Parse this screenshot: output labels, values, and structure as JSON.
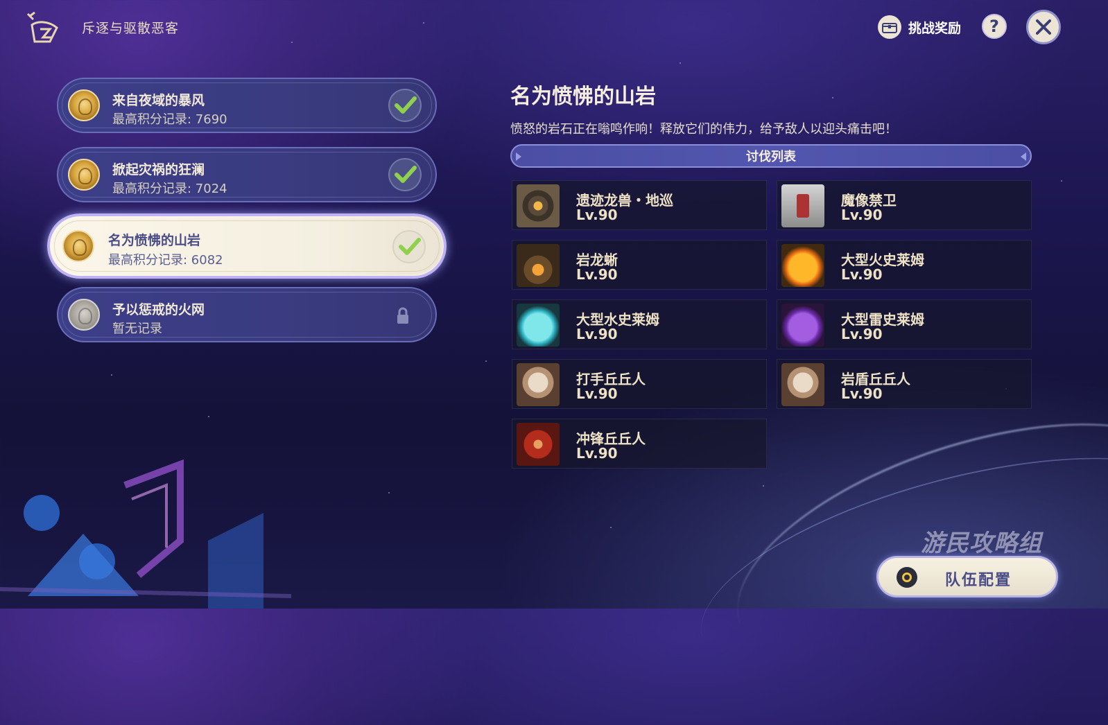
{
  "header": {
    "title": "斥逐与驱散恶客",
    "reward_label": "挑战奖励",
    "help_label": "?",
    "icons": {
      "logo": "event-emblem-icon",
      "reward": "chest-icon",
      "help": "question-icon",
      "close": "close-icon"
    }
  },
  "stages": [
    {
      "name": "来自夜域的暴风",
      "score": "最高积分记录: 7690",
      "status": "completed"
    },
    {
      "name": "掀起灾祸的狂澜",
      "score": "最高积分记录: 7024",
      "status": "completed"
    },
    {
      "name": "名为愤怫的山岩",
      "score": "最高积分记录: 6082",
      "status": "completed-selected"
    },
    {
      "name": "予以惩戒的火网",
      "score": "暂无记录",
      "status": "locked"
    }
  ],
  "detail": {
    "title": "名为愤怫的山岩",
    "description": "愤怒的岩石正在嗡鸣作响！释放它们的伟力，给予敌人以迎头痛击吧！",
    "list_title": "讨伐列表"
  },
  "enemies": [
    {
      "name": "遗迹龙兽・地巡",
      "level": "Lv.90",
      "portrait": "ruin-drake-portrait"
    },
    {
      "name": "魔像禁卫",
      "level": "Lv.90",
      "portrait": "golem-guard-portrait"
    },
    {
      "name": "岩龙蜥",
      "level": "Lv.90",
      "portrait": "geovishap-portrait"
    },
    {
      "name": "大型火史莱姆",
      "level": "Lv.90",
      "portrait": "pyro-slime-portrait"
    },
    {
      "name": "大型水史莱姆",
      "level": "Lv.90",
      "portrait": "hydro-slime-portrait"
    },
    {
      "name": "大型雷史莱姆",
      "level": "Lv.90",
      "portrait": "electro-slime-portrait"
    },
    {
      "name": "打手丘丘人",
      "level": "Lv.90",
      "portrait": "hilichurl-fighter-portrait"
    },
    {
      "name": "岩盾丘丘人",
      "level": "Lv.90",
      "portrait": "hilichurl-shield-portrait"
    },
    {
      "name": "冲锋丘丘人",
      "level": "Lv.90",
      "portrait": "hilichurl-berserker-portrait"
    }
  ],
  "team_button": {
    "label": "队伍配置"
  },
  "watermark": "游民攻略组",
  "colors": {
    "accent": "#494c86",
    "check": "#8fd14f",
    "panel": "#3c3e88",
    "text": "#ece5d6"
  }
}
